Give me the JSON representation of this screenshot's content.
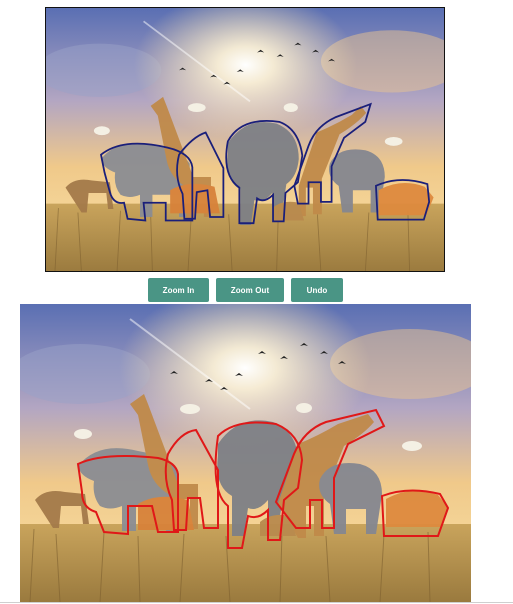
{
  "toolbar": {
    "zoom_in_label": "Zoom In",
    "zoom_out_label": "Zoom Out",
    "undo_label": "Undo"
  },
  "top_image": {
    "outline_color": "#1a1f7a"
  },
  "bottom_image": {
    "outline_color": "#e01818"
  },
  "colors": {
    "button_bg": "#4a9585",
    "button_text": "#ffffff"
  }
}
